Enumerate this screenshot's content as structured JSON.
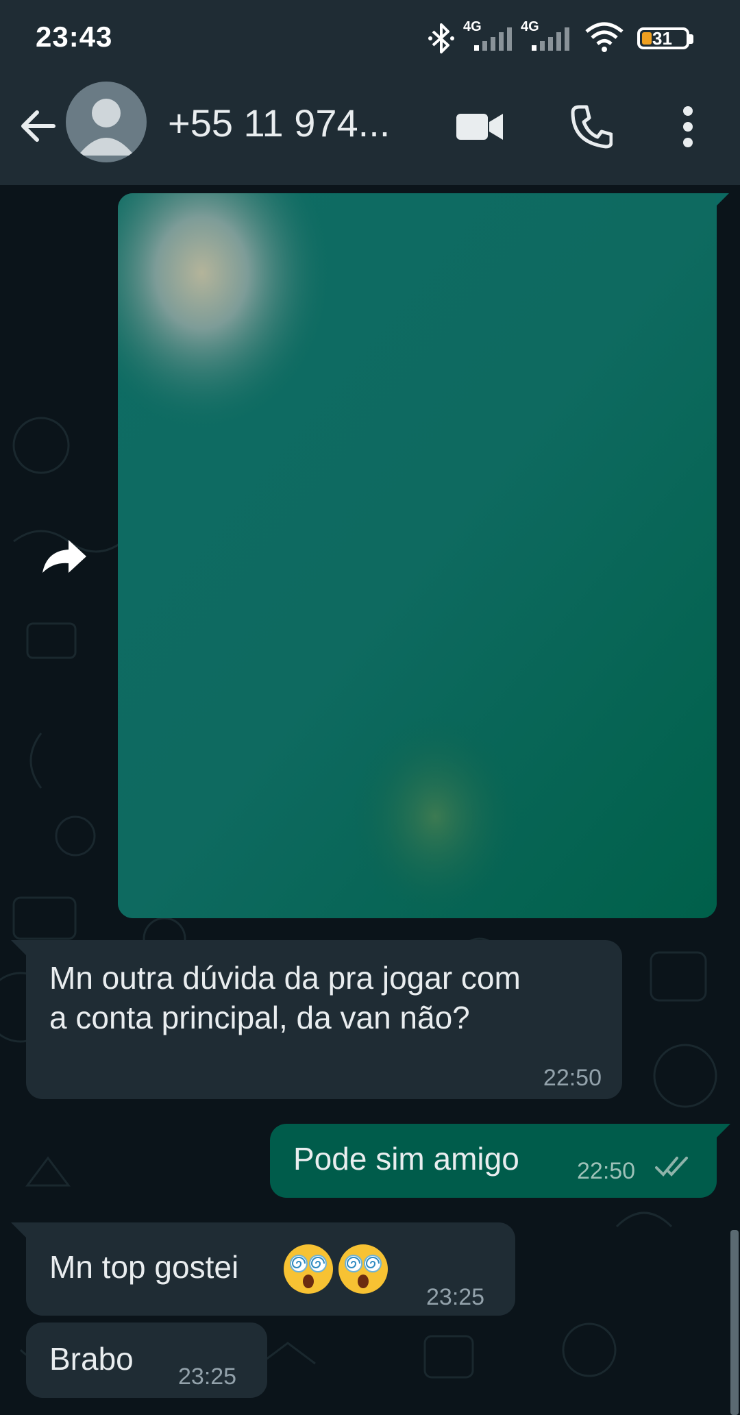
{
  "status_bar": {
    "time": "23:43",
    "network1": "4G",
    "network2": "4G",
    "battery": "31",
    "icons": [
      "bluetooth-icon",
      "signal-icon",
      "signal-icon",
      "wifi-icon",
      "battery-icon"
    ]
  },
  "header": {
    "contact_name": "+55 11 974...",
    "icons": [
      "back-arrow-icon",
      "avatar-icon",
      "video-call-icon",
      "phone-icon",
      "more-vertical-icon"
    ]
  },
  "messages": [
    {
      "type": "media",
      "direction": "outgoing"
    },
    {
      "type": "text",
      "direction": "incoming",
      "line1": "Mn outra dúvida da pra jogar com",
      "line2": "a conta principal, da van não?",
      "time": "22:50"
    },
    {
      "type": "text",
      "direction": "outgoing",
      "text": "Pode sim amigo",
      "time": "22:50",
      "status": "read"
    },
    {
      "type": "text",
      "direction": "incoming",
      "text": "Mn top gostei",
      "emoji": "dizzy-face-emoji",
      "emoji_count": 2,
      "time": "23:25"
    },
    {
      "type": "text",
      "direction": "incoming",
      "text": "Brabo",
      "time": "23:25"
    }
  ],
  "colors": {
    "background": "#0b141a",
    "header": "#1f2c34",
    "incoming_bubble": "#1f2c34",
    "outgoing_bubble": "#005c4b",
    "text": "#e9edef",
    "battery_accent": "#f0a020"
  }
}
